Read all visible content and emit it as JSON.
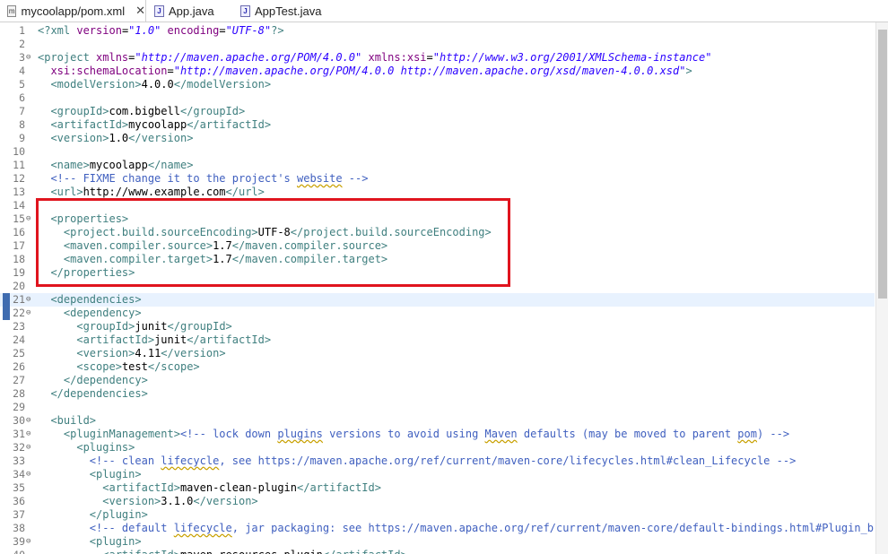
{
  "tabs": [
    {
      "label": "mycoolapp/pom.xml",
      "close": "✕",
      "icon": "xml-file-icon"
    },
    {
      "label": "App.java",
      "icon": "java-file-icon"
    },
    {
      "label": "AppTest.java",
      "icon": "java-file-icon"
    }
  ],
  "lines": [
    {
      "n": "1",
      "tokens": [
        [
          "tag",
          "<?xml "
        ],
        [
          "attr",
          "version"
        ],
        [
          "txt",
          "="
        ],
        [
          "str",
          "\"1.0\""
        ],
        [
          "txt",
          " "
        ],
        [
          "attr",
          "encoding"
        ],
        [
          "txt",
          "="
        ],
        [
          "str",
          "\"UTF-8\""
        ],
        [
          "tag",
          "?>"
        ]
      ]
    },
    {
      "n": "2",
      "tokens": []
    },
    {
      "n": "3",
      "fold": "⊖",
      "tokens": [
        [
          "tag",
          "<project "
        ],
        [
          "attr",
          "xmlns"
        ],
        [
          "txt",
          "="
        ],
        [
          "str",
          "\"http://maven.apache.org/POM/4.0.0\""
        ],
        [
          "txt",
          " "
        ],
        [
          "attr",
          "xmlns:xsi"
        ],
        [
          "txt",
          "="
        ],
        [
          "str",
          "\"http://www.w3.org/2001/XMLSchema-instance\""
        ]
      ]
    },
    {
      "n": "4",
      "tokens": [
        [
          "txt",
          "  "
        ],
        [
          "attr",
          "xsi:schemaLocation"
        ],
        [
          "txt",
          "="
        ],
        [
          "str",
          "\"http://maven.apache.org/POM/4.0.0 http://maven.apache.org/xsd/maven-4.0.0.xsd\""
        ],
        [
          "tag",
          ">"
        ]
      ]
    },
    {
      "n": "5",
      "tokens": [
        [
          "txt",
          "  "
        ],
        [
          "tag",
          "<modelVersion>"
        ],
        [
          "txt",
          "4.0.0"
        ],
        [
          "tag",
          "</modelVersion>"
        ]
      ]
    },
    {
      "n": "6",
      "tokens": []
    },
    {
      "n": "7",
      "tokens": [
        [
          "txt",
          "  "
        ],
        [
          "tag",
          "<groupId>"
        ],
        [
          "txt",
          "com.bigbell"
        ],
        [
          "tag",
          "</groupId>"
        ]
      ]
    },
    {
      "n": "8",
      "tokens": [
        [
          "txt",
          "  "
        ],
        [
          "tag",
          "<artifactId>"
        ],
        [
          "txt",
          "mycoolapp"
        ],
        [
          "tag",
          "</artifactId>"
        ]
      ]
    },
    {
      "n": "9",
      "tokens": [
        [
          "txt",
          "  "
        ],
        [
          "tag",
          "<version>"
        ],
        [
          "txt",
          "1.0"
        ],
        [
          "tag",
          "</version>"
        ]
      ]
    },
    {
      "n": "10",
      "tokens": []
    },
    {
      "n": "11",
      "tokens": [
        [
          "txt",
          "  "
        ],
        [
          "tag",
          "<name>"
        ],
        [
          "txt",
          "mycoolapp"
        ],
        [
          "tag",
          "</name>"
        ]
      ]
    },
    {
      "n": "12",
      "tokens": [
        [
          "txt",
          "  "
        ],
        [
          "cmt",
          "<!-- FIXME change it to the project's "
        ],
        [
          "cmtu",
          "website"
        ],
        [
          "cmt",
          " -->"
        ]
      ]
    },
    {
      "n": "13",
      "tokens": [
        [
          "txt",
          "  "
        ],
        [
          "tag",
          "<url>"
        ],
        [
          "txt",
          "http://www.example.com"
        ],
        [
          "tag",
          "</url>"
        ]
      ]
    },
    {
      "n": "14",
      "tokens": []
    },
    {
      "n": "15",
      "fold": "⊖",
      "tokens": [
        [
          "txt",
          "  "
        ],
        [
          "tag",
          "<properties>"
        ]
      ]
    },
    {
      "n": "16",
      "tokens": [
        [
          "txt",
          "    "
        ],
        [
          "tag",
          "<project.build.sourceEncoding>"
        ],
        [
          "txt",
          "UTF-8"
        ],
        [
          "tag",
          "</project.build.sourceEncoding>"
        ]
      ]
    },
    {
      "n": "17",
      "tokens": [
        [
          "txt",
          "    "
        ],
        [
          "tag",
          "<maven.compiler.source>"
        ],
        [
          "txt",
          "1.7"
        ],
        [
          "tag",
          "</maven.compiler.source>"
        ]
      ]
    },
    {
      "n": "18",
      "tokens": [
        [
          "txt",
          "    "
        ],
        [
          "tag",
          "<maven.compiler.target>"
        ],
        [
          "txt",
          "1.7"
        ],
        [
          "tag",
          "</maven.compiler.target>"
        ]
      ]
    },
    {
      "n": "19",
      "tokens": [
        [
          "txt",
          "  "
        ],
        [
          "tag",
          "</properties>"
        ]
      ]
    },
    {
      "n": "20",
      "tokens": []
    },
    {
      "n": "21",
      "fold": "⊖",
      "marker": true,
      "current": true,
      "tokens": [
        [
          "txt",
          "  "
        ],
        [
          "tag",
          "<dependencies>"
        ]
      ]
    },
    {
      "n": "22",
      "fold": "⊖",
      "marker": true,
      "tokens": [
        [
          "txt",
          "    "
        ],
        [
          "tag",
          "<dependency>"
        ]
      ]
    },
    {
      "n": "23",
      "tokens": [
        [
          "txt",
          "      "
        ],
        [
          "tag",
          "<groupId>"
        ],
        [
          "txt",
          "junit"
        ],
        [
          "tag",
          "</groupId>"
        ]
      ]
    },
    {
      "n": "24",
      "tokens": [
        [
          "txt",
          "      "
        ],
        [
          "tag",
          "<artifactId>"
        ],
        [
          "txt",
          "junit"
        ],
        [
          "tag",
          "</artifactId>"
        ]
      ]
    },
    {
      "n": "25",
      "tokens": [
        [
          "txt",
          "      "
        ],
        [
          "tag",
          "<version>"
        ],
        [
          "txt",
          "4.11"
        ],
        [
          "tag",
          "</version>"
        ]
      ]
    },
    {
      "n": "26",
      "tokens": [
        [
          "txt",
          "      "
        ],
        [
          "tag",
          "<scope>"
        ],
        [
          "txt",
          "test"
        ],
        [
          "tag",
          "</scope>"
        ]
      ]
    },
    {
      "n": "27",
      "tokens": [
        [
          "txt",
          "    "
        ],
        [
          "tag",
          "</dependency>"
        ]
      ]
    },
    {
      "n": "28",
      "tokens": [
        [
          "txt",
          "  "
        ],
        [
          "tag",
          "</dependencies>"
        ]
      ]
    },
    {
      "n": "29",
      "tokens": []
    },
    {
      "n": "30",
      "fold": "⊖",
      "tokens": [
        [
          "txt",
          "  "
        ],
        [
          "tag",
          "<build>"
        ]
      ]
    },
    {
      "n": "31",
      "fold": "⊖",
      "tokens": [
        [
          "txt",
          "    "
        ],
        [
          "tag",
          "<pluginManagement>"
        ],
        [
          "cmt",
          "<!-- lock down "
        ],
        [
          "cmtu",
          "plugins"
        ],
        [
          "cmt",
          " versions to avoid using "
        ],
        [
          "cmtu",
          "Maven"
        ],
        [
          "cmt",
          " defaults (may be moved to parent "
        ],
        [
          "cmtu",
          "pom"
        ],
        [
          "cmt",
          ") -->"
        ]
      ]
    },
    {
      "n": "32",
      "fold": "⊖",
      "tokens": [
        [
          "txt",
          "      "
        ],
        [
          "tag",
          "<plugins>"
        ]
      ]
    },
    {
      "n": "33",
      "tokens": [
        [
          "txt",
          "        "
        ],
        [
          "cmt",
          "<!-- clean "
        ],
        [
          "cmtu",
          "lifecycle"
        ],
        [
          "cmt",
          ", see https://maven.apache.org/ref/current/maven-core/lifecycles.html#clean_Lifecycle -->"
        ]
      ]
    },
    {
      "n": "34",
      "fold": "⊖",
      "tokens": [
        [
          "txt",
          "        "
        ],
        [
          "tag",
          "<plugin>"
        ]
      ]
    },
    {
      "n": "35",
      "tokens": [
        [
          "txt",
          "          "
        ],
        [
          "tag",
          "<artifactId>"
        ],
        [
          "txt",
          "maven-clean-plugin"
        ],
        [
          "tag",
          "</artifactId>"
        ]
      ]
    },
    {
      "n": "36",
      "tokens": [
        [
          "txt",
          "          "
        ],
        [
          "tag",
          "<version>"
        ],
        [
          "txt",
          "3.1.0"
        ],
        [
          "tag",
          "</version>"
        ]
      ]
    },
    {
      "n": "37",
      "tokens": [
        [
          "txt",
          "        "
        ],
        [
          "tag",
          "</plugin>"
        ]
      ]
    },
    {
      "n": "38",
      "tokens": [
        [
          "txt",
          "        "
        ],
        [
          "cmt",
          "<!-- default "
        ],
        [
          "cmtu",
          "lifecycle"
        ],
        [
          "cmt",
          ", jar packaging: see https://maven.apache.org/ref/current/maven-core/default-bindings.html#Plugin_bindin"
        ]
      ]
    },
    {
      "n": "39",
      "fold": "⊖",
      "tokens": [
        [
          "txt",
          "        "
        ],
        [
          "tag",
          "<plugin>"
        ]
      ]
    },
    {
      "n": "40",
      "tokens": [
        [
          "txt",
          "          "
        ],
        [
          "tag",
          "<artifactId>"
        ],
        [
          "txt",
          "maven-resources-plugin"
        ],
        [
          "tag",
          "</artifactId>"
        ]
      ]
    }
  ]
}
